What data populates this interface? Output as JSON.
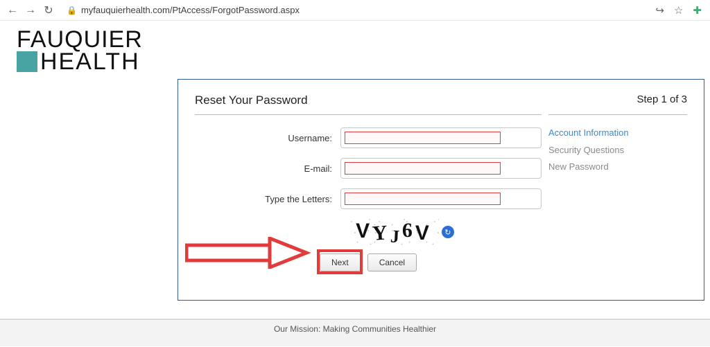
{
  "browser": {
    "url": "myfauquierhealth.com/PtAccess/ForgotPassword.aspx"
  },
  "logo": {
    "line1": "FAUQUIER",
    "line2": "HEALTH"
  },
  "card": {
    "title": "Reset Your Password",
    "step_text": "Step 1 of 3",
    "steps": [
      {
        "label": "Account Information",
        "state": "active"
      },
      {
        "label": "Security Questions",
        "state": "inactive"
      },
      {
        "label": "New Password",
        "state": "inactive"
      }
    ],
    "fields": {
      "username_label": "Username:",
      "email_label": "E-mail:",
      "captcha_label": "Type the Letters:"
    },
    "captcha_text": "VYJ6V",
    "buttons": {
      "next": "Next",
      "cancel": "Cancel"
    }
  },
  "footer": {
    "text": "Our Mission: Making Communities Healthier"
  }
}
